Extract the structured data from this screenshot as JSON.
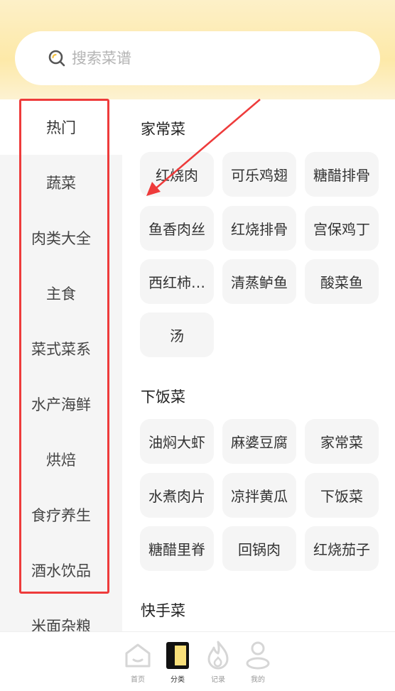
{
  "search": {
    "placeholder": "搜索菜谱"
  },
  "sidebar": {
    "items": [
      {
        "label": "热门"
      },
      {
        "label": "蔬菜"
      },
      {
        "label": "肉类大全"
      },
      {
        "label": "主食"
      },
      {
        "label": "菜式菜系"
      },
      {
        "label": "水产海鲜"
      },
      {
        "label": "烘焙"
      },
      {
        "label": "食疗养生"
      },
      {
        "label": "酒水饮品"
      },
      {
        "label": "米面杂粮"
      }
    ]
  },
  "sections": [
    {
      "title": "家常菜",
      "chips": [
        "红烧肉",
        "可乐鸡翅",
        "糖醋排骨",
        "鱼香肉丝",
        "红烧排骨",
        "宫保鸡丁",
        "西红柿…",
        "清蒸鲈鱼",
        "酸菜鱼",
        "汤"
      ]
    },
    {
      "title": "下饭菜",
      "chips": [
        "油焖大虾",
        "麻婆豆腐",
        "家常菜",
        "水煮肉片",
        "凉拌黄瓜",
        "下饭菜",
        "糖醋里脊",
        "回锅肉",
        "红烧茄子"
      ]
    },
    {
      "title": "快手菜",
      "chips": []
    }
  ],
  "tabbar": {
    "tabs": [
      {
        "label": "首页",
        "icon": "home-icon"
      },
      {
        "label": "分类",
        "icon": "category-icon"
      },
      {
        "label": "记录",
        "icon": "flame-icon"
      },
      {
        "label": "我的",
        "icon": "user-icon"
      }
    ]
  },
  "colors": {
    "annotation": "#ee3b3b",
    "header": "#fde9a8",
    "sidebar_bg": "#f5f5f5",
    "chip_bg": "#f5f5f5"
  }
}
